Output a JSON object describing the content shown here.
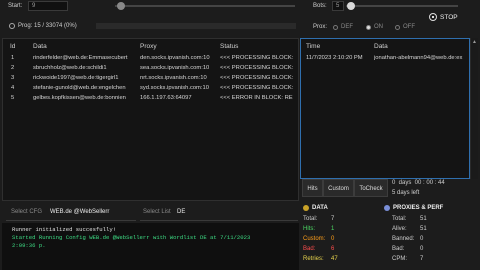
{
  "top": {
    "start_label": "Start:",
    "start_value": "9",
    "bots_label": "Bots:",
    "bots_value": "5",
    "prog_text": "Prog: 15 / 33074 (0%)",
    "prox_label": "Prox:",
    "prox_options": [
      "DEF",
      "ON",
      "OFF"
    ],
    "prox_selected": "ON",
    "stop_label": "STOP"
  },
  "grid": {
    "columns": [
      "Id",
      "Data",
      "Proxy",
      "Status"
    ],
    "rows": [
      {
        "id": "1",
        "data": "rinderfelder@web.de:Emmasecubert",
        "proxy": "den.socks.ipvanish.com:10",
        "status": "<<< PROCESSING BLOCK:"
      },
      {
        "id": "2",
        "data": "sbruchholz@web.de:schildi1",
        "proxy": "sea.socks.ipvanish.com:10",
        "status": "<<< PROCESSING BLOCK:"
      },
      {
        "id": "3",
        "data": "rickwoide1997@web.de:tigergirl1",
        "proxy": "nrt.socks.ipvanish.com:10",
        "status": "<<< PROCESSING BLOCK:"
      },
      {
        "id": "4",
        "data": "stefanie-gunold@web.de:engelchen",
        "proxy": "syd.socks.ipvanish.com:10",
        "status": "<<< PROCESSING BLOCK:"
      },
      {
        "id": "5",
        "data": "gelbes.kopfkissen@web.de:bonnien",
        "proxy": "166.1.197.63:64097",
        "status": "<<< ERROR IN BLOCK: RE"
      }
    ]
  },
  "hits": {
    "columns": [
      "Time",
      "Data"
    ],
    "rows": [
      {
        "time": "11/7/2023 2:10:20 PM",
        "data": "jonathan-abelmann94@web.de:ex"
      }
    ]
  },
  "hits_tabs": [
    "Hits",
    "Custom",
    "ToCheck"
  ],
  "timer": {
    "elapsed": "0  days  00 : 00 : 44",
    "left": "5 days left"
  },
  "log": {
    "select_cfg_label": "Select CFG",
    "cfg_value": "WEB.de @WebSellerr",
    "select_list_label": "Select List",
    "list_value": "DE",
    "lines": [
      "Runner initialized succesfully!",
      "Started Running Config WEB.de @WebSellerr with Wordlist DE at 7/11/2023",
      "2:09:36 p."
    ]
  },
  "data_stats": {
    "title": "DATA",
    "items": [
      {
        "label": "Total:",
        "value": "7"
      },
      {
        "label": "Hits:",
        "value": "1"
      },
      {
        "label": "Custom:",
        "value": "0"
      },
      {
        "label": "Bad:",
        "value": "6"
      },
      {
        "label": "Retries:",
        "value": "47"
      }
    ]
  },
  "proxy_stats": {
    "title": "PROXIES & PERF",
    "items": [
      {
        "label": "Total:",
        "value": "51"
      },
      {
        "label": "Alive:",
        "value": "51"
      },
      {
        "label": "Banned:",
        "value": "0"
      },
      {
        "label": "Bad:",
        "value": "0"
      },
      {
        "label": "CPM:",
        "value": "7"
      }
    ]
  },
  "colors": {
    "accent_blue": "#1e88e5",
    "log_green": "#3ddc84",
    "hits_green": "#4cd964",
    "custom_orange": "#ff9f1a",
    "bad_red": "#ff4d4d",
    "retries_yellow": "#e8d44d"
  }
}
